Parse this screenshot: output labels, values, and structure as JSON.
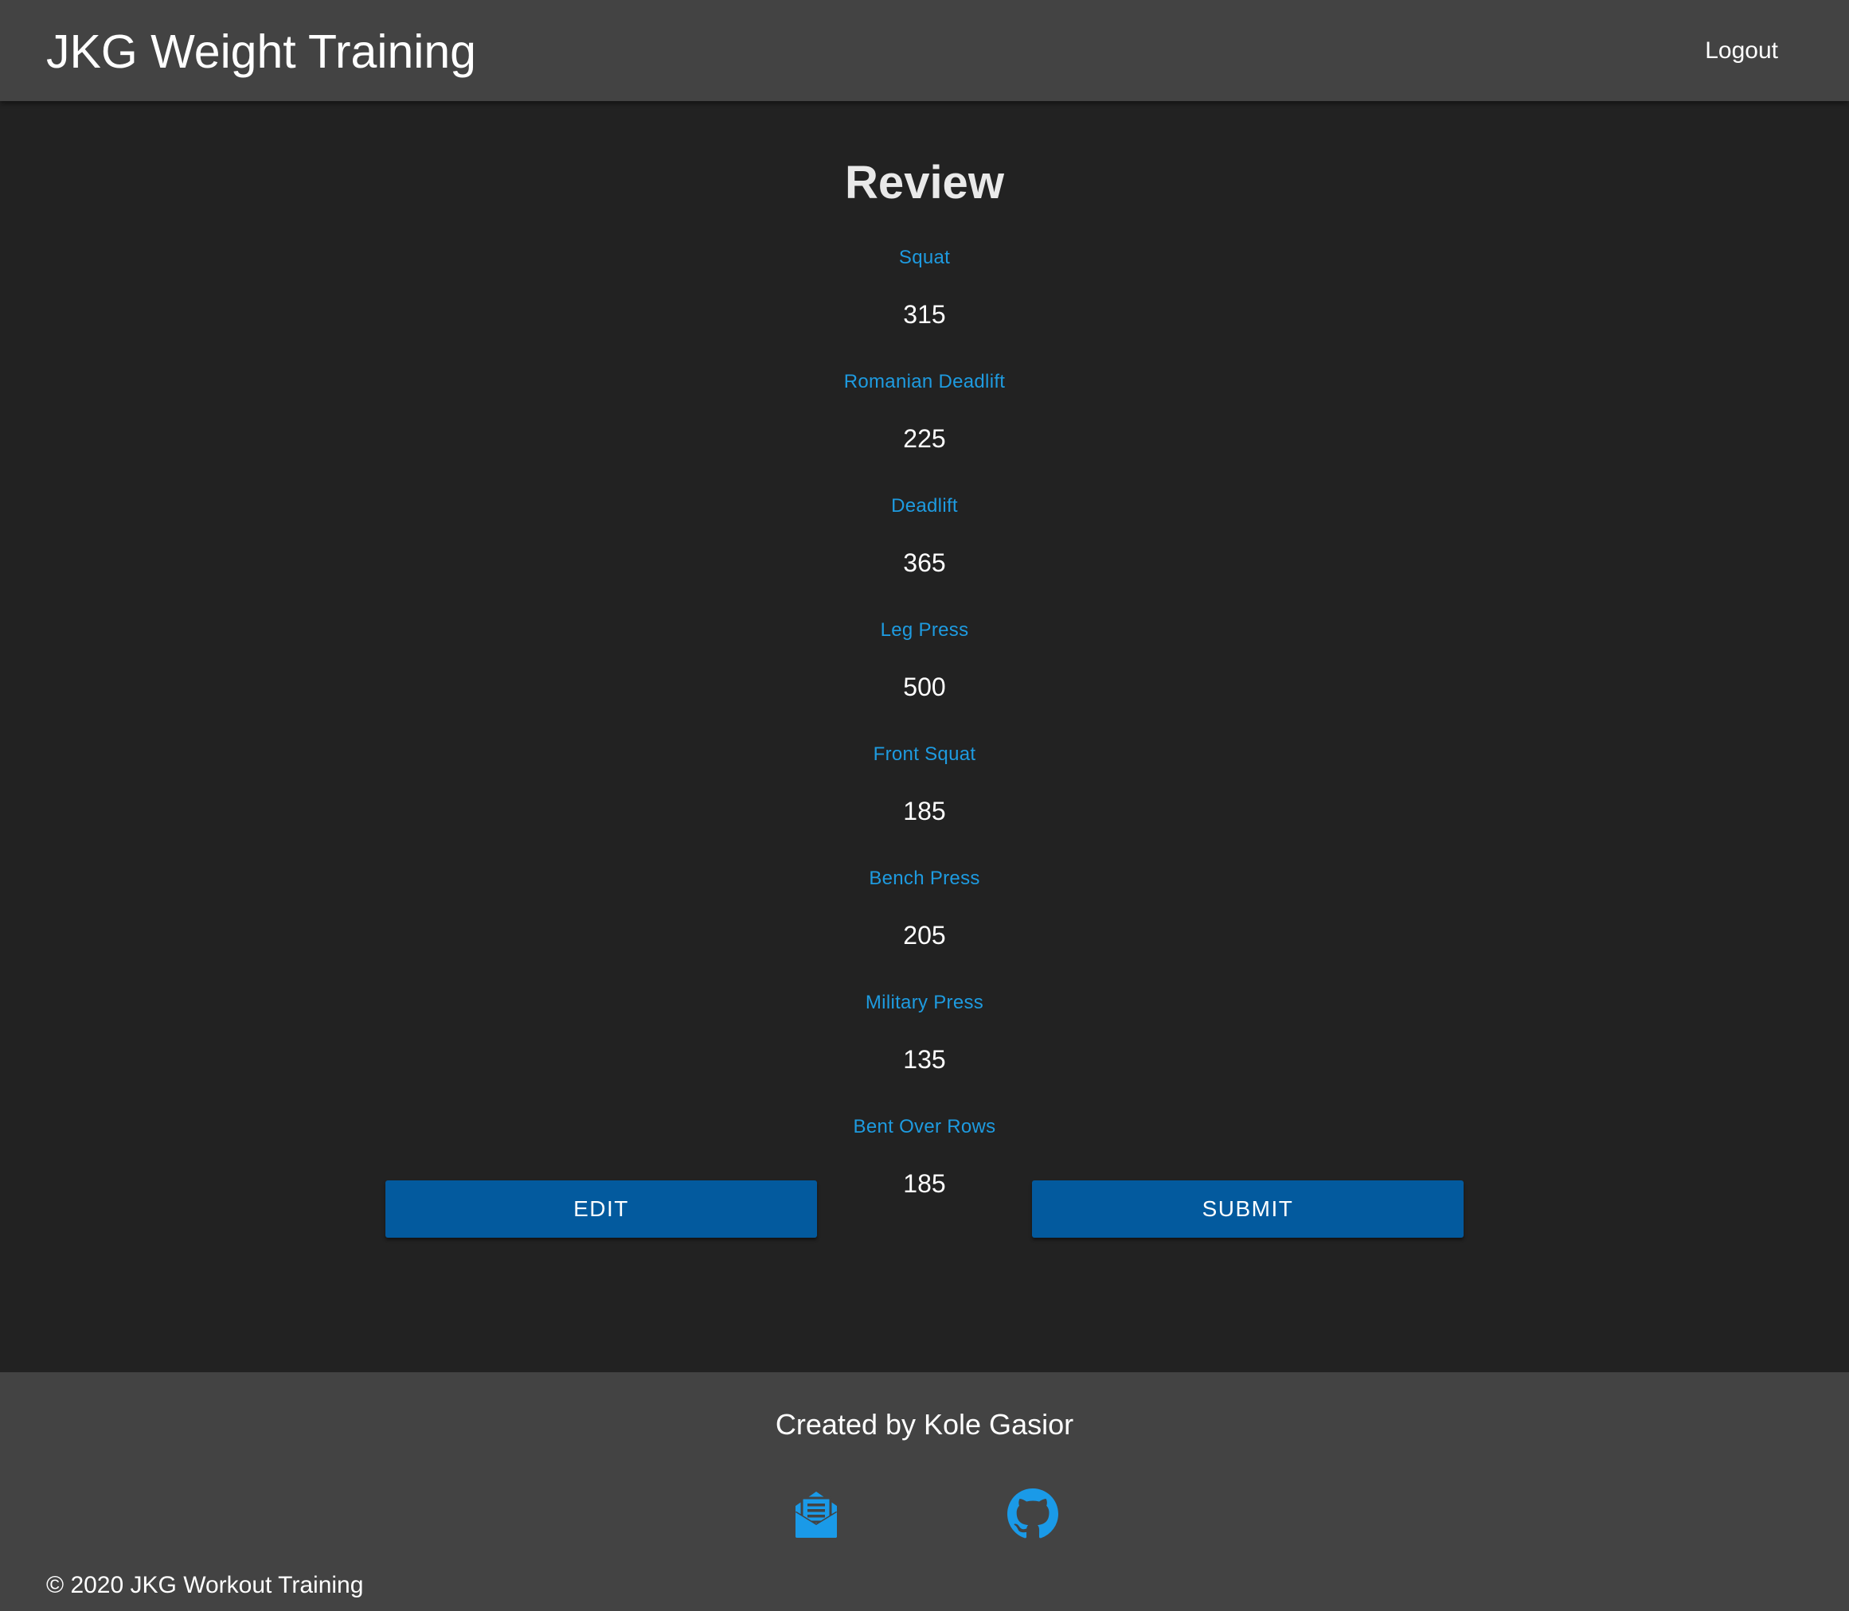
{
  "header": {
    "brand": "JKG Weight Training",
    "logout_label": "Logout"
  },
  "main": {
    "title": "Review",
    "exercises": [
      {
        "label": "Squat",
        "value": "315"
      },
      {
        "label": "Romanian Deadlift",
        "value": "225"
      },
      {
        "label": "Deadlift",
        "value": "365"
      },
      {
        "label": "Leg Press",
        "value": "500"
      },
      {
        "label": "Front Squat",
        "value": "185"
      },
      {
        "label": "Bench Press",
        "value": "205"
      },
      {
        "label": "Military Press",
        "value": "135"
      },
      {
        "label": "Bent Over Rows",
        "value": "185"
      }
    ],
    "edit_label": "EDIT",
    "submit_label": "SUBMIT"
  },
  "footer": {
    "credit": "Created by Kole Gasior",
    "copyright": "© 2020 JKG Workout Training",
    "icons": [
      "mail-icon",
      "github-icon"
    ]
  },
  "colors": {
    "header_bg": "#434343",
    "page_bg": "#222222",
    "accent_label": "#1e9be0",
    "button_bg": "#035a9e",
    "icon_blue": "#1a9ae8"
  }
}
